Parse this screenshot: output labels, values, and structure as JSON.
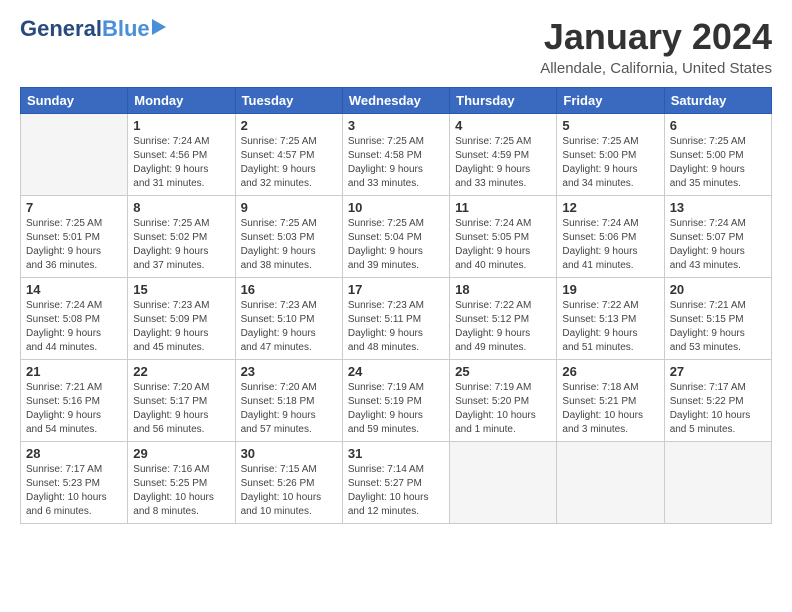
{
  "logo": {
    "general": "General",
    "blue": "Blue"
  },
  "title": "January 2024",
  "location": "Allendale, California, United States",
  "days_of_week": [
    "Sunday",
    "Monday",
    "Tuesday",
    "Wednesday",
    "Thursday",
    "Friday",
    "Saturday"
  ],
  "weeks": [
    [
      {
        "day": "",
        "info": ""
      },
      {
        "day": "1",
        "info": "Sunrise: 7:24 AM\nSunset: 4:56 PM\nDaylight: 9 hours\nand 31 minutes."
      },
      {
        "day": "2",
        "info": "Sunrise: 7:25 AM\nSunset: 4:57 PM\nDaylight: 9 hours\nand 32 minutes."
      },
      {
        "day": "3",
        "info": "Sunrise: 7:25 AM\nSunset: 4:58 PM\nDaylight: 9 hours\nand 33 minutes."
      },
      {
        "day": "4",
        "info": "Sunrise: 7:25 AM\nSunset: 4:59 PM\nDaylight: 9 hours\nand 33 minutes."
      },
      {
        "day": "5",
        "info": "Sunrise: 7:25 AM\nSunset: 5:00 PM\nDaylight: 9 hours\nand 34 minutes."
      },
      {
        "day": "6",
        "info": "Sunrise: 7:25 AM\nSunset: 5:00 PM\nDaylight: 9 hours\nand 35 minutes."
      }
    ],
    [
      {
        "day": "7",
        "info": "Sunrise: 7:25 AM\nSunset: 5:01 PM\nDaylight: 9 hours\nand 36 minutes."
      },
      {
        "day": "8",
        "info": "Sunrise: 7:25 AM\nSunset: 5:02 PM\nDaylight: 9 hours\nand 37 minutes."
      },
      {
        "day": "9",
        "info": "Sunrise: 7:25 AM\nSunset: 5:03 PM\nDaylight: 9 hours\nand 38 minutes."
      },
      {
        "day": "10",
        "info": "Sunrise: 7:25 AM\nSunset: 5:04 PM\nDaylight: 9 hours\nand 39 minutes."
      },
      {
        "day": "11",
        "info": "Sunrise: 7:24 AM\nSunset: 5:05 PM\nDaylight: 9 hours\nand 40 minutes."
      },
      {
        "day": "12",
        "info": "Sunrise: 7:24 AM\nSunset: 5:06 PM\nDaylight: 9 hours\nand 41 minutes."
      },
      {
        "day": "13",
        "info": "Sunrise: 7:24 AM\nSunset: 5:07 PM\nDaylight: 9 hours\nand 43 minutes."
      }
    ],
    [
      {
        "day": "14",
        "info": "Sunrise: 7:24 AM\nSunset: 5:08 PM\nDaylight: 9 hours\nand 44 minutes."
      },
      {
        "day": "15",
        "info": "Sunrise: 7:23 AM\nSunset: 5:09 PM\nDaylight: 9 hours\nand 45 minutes."
      },
      {
        "day": "16",
        "info": "Sunrise: 7:23 AM\nSunset: 5:10 PM\nDaylight: 9 hours\nand 47 minutes."
      },
      {
        "day": "17",
        "info": "Sunrise: 7:23 AM\nSunset: 5:11 PM\nDaylight: 9 hours\nand 48 minutes."
      },
      {
        "day": "18",
        "info": "Sunrise: 7:22 AM\nSunset: 5:12 PM\nDaylight: 9 hours\nand 49 minutes."
      },
      {
        "day": "19",
        "info": "Sunrise: 7:22 AM\nSunset: 5:13 PM\nDaylight: 9 hours\nand 51 minutes."
      },
      {
        "day": "20",
        "info": "Sunrise: 7:21 AM\nSunset: 5:15 PM\nDaylight: 9 hours\nand 53 minutes."
      }
    ],
    [
      {
        "day": "21",
        "info": "Sunrise: 7:21 AM\nSunset: 5:16 PM\nDaylight: 9 hours\nand 54 minutes."
      },
      {
        "day": "22",
        "info": "Sunrise: 7:20 AM\nSunset: 5:17 PM\nDaylight: 9 hours\nand 56 minutes."
      },
      {
        "day": "23",
        "info": "Sunrise: 7:20 AM\nSunset: 5:18 PM\nDaylight: 9 hours\nand 57 minutes."
      },
      {
        "day": "24",
        "info": "Sunrise: 7:19 AM\nSunset: 5:19 PM\nDaylight: 9 hours\nand 59 minutes."
      },
      {
        "day": "25",
        "info": "Sunrise: 7:19 AM\nSunset: 5:20 PM\nDaylight: 10 hours\nand 1 minute."
      },
      {
        "day": "26",
        "info": "Sunrise: 7:18 AM\nSunset: 5:21 PM\nDaylight: 10 hours\nand 3 minutes."
      },
      {
        "day": "27",
        "info": "Sunrise: 7:17 AM\nSunset: 5:22 PM\nDaylight: 10 hours\nand 5 minutes."
      }
    ],
    [
      {
        "day": "28",
        "info": "Sunrise: 7:17 AM\nSunset: 5:23 PM\nDaylight: 10 hours\nand 6 minutes."
      },
      {
        "day": "29",
        "info": "Sunrise: 7:16 AM\nSunset: 5:25 PM\nDaylight: 10 hours\nand 8 minutes."
      },
      {
        "day": "30",
        "info": "Sunrise: 7:15 AM\nSunset: 5:26 PM\nDaylight: 10 hours\nand 10 minutes."
      },
      {
        "day": "31",
        "info": "Sunrise: 7:14 AM\nSunset: 5:27 PM\nDaylight: 10 hours\nand 12 minutes."
      },
      {
        "day": "",
        "info": ""
      },
      {
        "day": "",
        "info": ""
      },
      {
        "day": "",
        "info": ""
      }
    ]
  ]
}
